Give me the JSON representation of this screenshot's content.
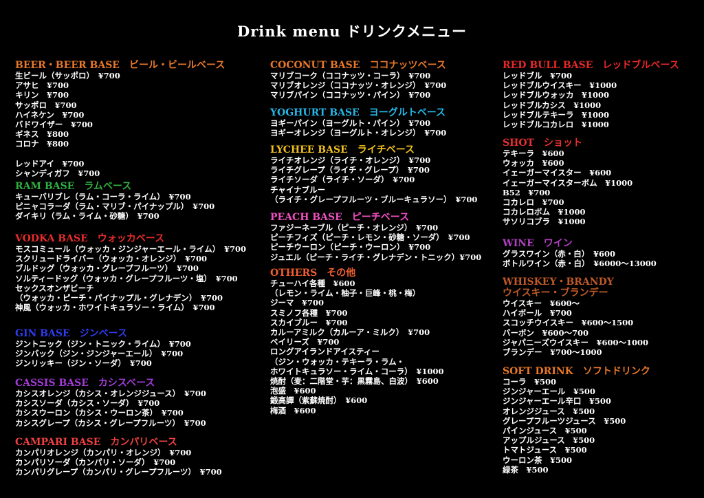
{
  "title": "Drink menu ドリンクメニュー",
  "colors": {
    "orange": "#e8782a",
    "green": "#2fb040",
    "red": "#e82c2c",
    "blue": "#2f3cf0",
    "purple": "#a23ad6",
    "campari": "#f04040",
    "coconut": "#e8782a",
    "yoghurt": "#25b8e8",
    "lychee": "#f0c020",
    "peach": "#f050c0",
    "others": "#f06030",
    "redbull": "#e82828",
    "shot": "#e83030",
    "wine": "#b040c0",
    "whiskey": "#c05a28",
    "soft": "#e87828"
  },
  "sections": {
    "beer": {
      "heading": "BEER・BEER BASE　ビール・ビールベース",
      "items": [
        "生ビール（サッポロ）　¥700",
        "アサヒ　¥700",
        "キリン　¥700",
        "サッポロ　¥700",
        "ハイネケン　¥700",
        "バドワイザー　¥700",
        "ギネス　¥800",
        "コロナ　¥800",
        "",
        "レッドアイ　¥700",
        "シャンディガフ　¥700"
      ]
    },
    "ram": {
      "heading": "RAM BASE　ラムベース",
      "items": [
        "キューバリブレ（ラム・コーラ・ライム）　¥700",
        "ピニャコラーダ（ラム・マリブ・パイナップル）　¥700",
        "ダイキリ（ラム・ライム・砂糖）　¥700"
      ]
    },
    "vodka": {
      "heading": "VODKA BASE　ウォッカベース",
      "items": [
        "モスコミュール（ウォッカ・ジンジャーエール・ライム）　¥700",
        "スクリュードライバー（ウォッカ・オレンジ）　¥700",
        "ブルドッグ（ウォッカ・グレープフルーツ）　¥700",
        "ソルティードッグ（ウォッカ・グレープフルーツ・塩）　¥700",
        "セックスオンザビーチ",
        "（ウォッカ・ピーチ・パイナップル・グレナデン）　¥700",
        "神風（ウォッカ・ホワイトキュラソー・ライム）　¥700"
      ]
    },
    "gin": {
      "heading": "GIN BASE　ジンベース",
      "items": [
        "ジントニック（ジン・トニック・ライム）　¥700",
        "ジンバック（ジン・ジンジャーエール）　¥700",
        "ジンリッキー（ジン・ソーダ）　¥700"
      ]
    },
    "cassis": {
      "heading": "CASSIS BASE　カシスベース",
      "items": [
        "カシスオレンジ（カシス・オレンジジュース）　¥700",
        "カシスソーダ（カシス・ソーダ）　¥700",
        "カシスウーロン（カシス・ウーロン茶）　¥700",
        "カシスグレープ（カシス・グレープフルーツ）　¥700"
      ]
    },
    "campari": {
      "heading": "CAMPARI BASE　カンパリベース",
      "items": [
        "カンパリオレンジ（カンパリ・オレンジ）　¥700",
        "カンパリソーダ（カンパリ・ソーダ）　¥700",
        "カンパリグレープ（カンパリ・グレープフルーツ）　¥700"
      ]
    },
    "coconut": {
      "heading": "COCONUT BASE　ココナッツベース",
      "items": [
        "マリブコーク（ココナッツ・コーラ）　¥700",
        "マリブオレンジ（ココナッツ・オレンジ）　¥700",
        "マリブパイン（ココナッツ・パイン）　¥700"
      ]
    },
    "yoghurt": {
      "heading": "YOGHURT BASE　ヨーグルトベース",
      "items": [
        "ヨギーパイン（ヨーグルト・パイン）　¥700",
        "ヨギーオレンジ（ヨーグルト・オレンジ）　¥700"
      ]
    },
    "lychee": {
      "heading": "LYCHEE BASE　ライチベース",
      "items": [
        "ライチオレンジ（ライチ・オレンジ）　¥700",
        "ライチグレープ（ライチ・グレープ）　¥700",
        "ライチソーダ（ライチ・ソーダ）　¥700",
        "チャイナブルー",
        "（ライチ・グレープフルーツ・ブルーキュラソー）　¥700"
      ]
    },
    "peach": {
      "heading": "PEACH BASE　ピーチベース",
      "items": [
        "ファジーネーブル（ピーチ・オレンジ）　¥700",
        "ピーチフィズ（ピーチ・レモン・砂糖・ソーダ）　¥700",
        "ピーチウーロン（ピーチ・ウーロン）　¥700",
        "ジュエル（ピーチ・ライチ・グレナデン・トニック）¥700"
      ]
    },
    "others": {
      "heading": "OTHERS　その他",
      "items": [
        "チューハイ各種　¥600",
        "（レモン・ライム・柚子・巨峰・桃・梅）",
        "ジーマ　¥700",
        "スミノフ各種　¥700",
        "スカイブルー　¥700",
        "カルーアミルク（カルーア・ミルク）　¥700",
        "ベイリーズ　¥700",
        "ロングアイランドアイスティー",
        "（ジン・ウォッカ・テキーラ・ラム・",
        "ホワイトキュラソー・ライム・コーラ）　¥1000",
        "焼酎（麦：二階堂・芋：黒霧島、白波）　¥600",
        "泡盛　¥600",
        "鍛高譚（紫蘇焼酎）　¥600",
        "梅酒　¥600"
      ]
    },
    "redbull": {
      "heading": "RED BULL BASE　レッドブルベース",
      "items": [
        "レッドブル　¥700",
        "レッドブルウイスキー　¥1000",
        "レッドブルウォッカ　¥1000",
        "レッドブルカシス　¥1000",
        "レッドブルテキーラ　¥1000",
        "レッドブルコカレロ　¥1000"
      ]
    },
    "shot": {
      "heading": "SHOT　ショット",
      "items": [
        "テキーラ　¥600",
        "ウォッカ　¥600",
        "イェーガーマイスター　¥600",
        "イェーガーマイスターボム　¥1000",
        "B52　¥700",
        "コカレロ　¥700",
        "コカレロボム　¥1000",
        "サソリコブラ　¥1000"
      ]
    },
    "wine": {
      "heading": "WINE　ワイン",
      "items": [
        "グラスワイン（赤・白）　¥600",
        "ボトルワイン（赤・白）　¥6000～13000"
      ]
    },
    "whiskey": {
      "heading": "WHISKEY・BRANDY",
      "heading2": "ウイスキー・ブランデー",
      "items": [
        "ウイスキー　¥600～",
        "ハイボール　¥700",
        "スコッチウイスキー　¥600～1500",
        "バーボン　¥600～700",
        "ジャパニーズウイスキー　¥600～1000",
        "ブランデー　¥700～1000"
      ]
    },
    "soft": {
      "heading": "SOFT DRINK　ソフトドリンク",
      "items": [
        "コーラ　¥500",
        "ジンジャーエール　¥500",
        "ジンジャーエール辛口　¥500",
        "オレンジジュース　¥500",
        "グレープフルーツジュース　¥500",
        "パインジュース　¥500",
        "アップルジュース　¥500",
        "トマトジュース　¥500",
        "ウーロン茶　¥500",
        "緑茶　¥500"
      ]
    }
  }
}
